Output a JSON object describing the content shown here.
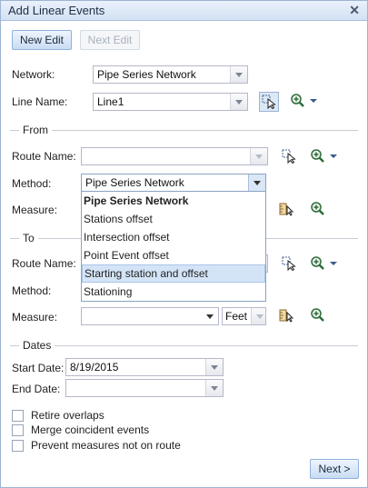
{
  "window": {
    "title": "Add Linear Events",
    "close_glyph": "✕"
  },
  "toolbar": {
    "new_edit_label": "New Edit",
    "next_edit_label": "Next Edit"
  },
  "network": {
    "label": "Network:",
    "value": "Pipe Series Network"
  },
  "line_name": {
    "label": "Line Name:",
    "value": "Line1"
  },
  "from": {
    "legend": "From",
    "route_name_label": "Route Name:",
    "route_name_value": "",
    "method_label": "Method:",
    "method_value": "Pipe Series Network",
    "measure_label": "Measure:"
  },
  "method_dropdown": {
    "options": [
      "Pipe Series Network",
      "Stations offset",
      "Intersection offset",
      "Point Event offset",
      "Starting station and offset",
      "Stationing"
    ],
    "highlighted": "Starting station and offset"
  },
  "to": {
    "legend": "To",
    "route_name_label": "Route Name:",
    "method_label": "Method:",
    "measure_label": "Measure:",
    "measure_value": "",
    "unit_value": "Feet"
  },
  "dates": {
    "legend": "Dates",
    "start_label": "Start Date:",
    "start_value": "8/19/2015",
    "end_label": "End Date:",
    "end_value": ""
  },
  "options": {
    "retire_overlaps": "Retire overlaps",
    "merge_coincident": "Merge coincident events",
    "prevent_measures": "Prevent measures not on route"
  },
  "footer": {
    "next_label": "Next >"
  },
  "colors": {
    "accent": "#8fb2dc",
    "title_bg": "#d3e1f3",
    "selection": "#d4e4f7"
  }
}
